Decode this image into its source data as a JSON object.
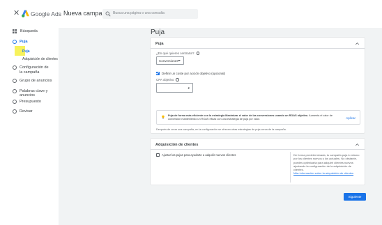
{
  "topbar": {
    "close_glyph": "✕",
    "brand": "Google Ads",
    "campaign_title": "Nueva campaña",
    "search_placeholder": "Busca una página o una consulta"
  },
  "sidebar": {
    "items": [
      {
        "label": "Búsqueda",
        "icon": "grid-icon"
      },
      {
        "label": "Puja"
      },
      {
        "label": "Puja"
      },
      {
        "label": "Adquisición de clientes"
      },
      {
        "label": "Configuración de la campaña"
      },
      {
        "label": "Grupo de anuncios"
      },
      {
        "label": "Palabras clave y anuncios"
      },
      {
        "label": "Presupuesto"
      },
      {
        "label": "Revisar"
      }
    ],
    "highlight_color": "#f7f25c"
  },
  "main": {
    "page_title": "Puja",
    "bid_card": {
      "header": "Puja",
      "question": "¿En qué quieres centrarte?",
      "focus_value": "Conversiones",
      "checkbox_label": "Definir un coste por acción objetivo (opcional)",
      "checkbox_checked": true,
      "cpa_label": "CPA objetivo",
      "cpa_currency": "€",
      "notice_bold": "Puja de forma más eficiente con la estrategia Maximizar el valor de las conversiones usando un ROAS objetivo.",
      "notice_text": " Aumenta el valor de conversión manteniendo un ROAS eficaz con una estrategia de puja por valor.",
      "notice_apply": "Aplicar",
      "footer_note": "Después de crear una campaña, en la configuración se ofrecen otras estrategias de puja cerca de la campaña."
    },
    "customer_card": {
      "header": "Adquisición de clientes",
      "checkbox_label": "Ajustar las pujas para ayudarte a adquirir nuevos clientes",
      "checkbox_checked": false,
      "help_text": "De forma predeterminada, tu campaña puja lo mismo por los clientes nuevos y los actuales. No obstante, puedes optimizarla para adquirir clientes nuevos ajustando la configuración de la adquisición de clientes.",
      "help_link": "Más información sobre la adquisición de clientes"
    },
    "next_button": "Siguiente"
  },
  "colors": {
    "accent": "#1a73e8",
    "page_bg": "#f1f3f4"
  }
}
